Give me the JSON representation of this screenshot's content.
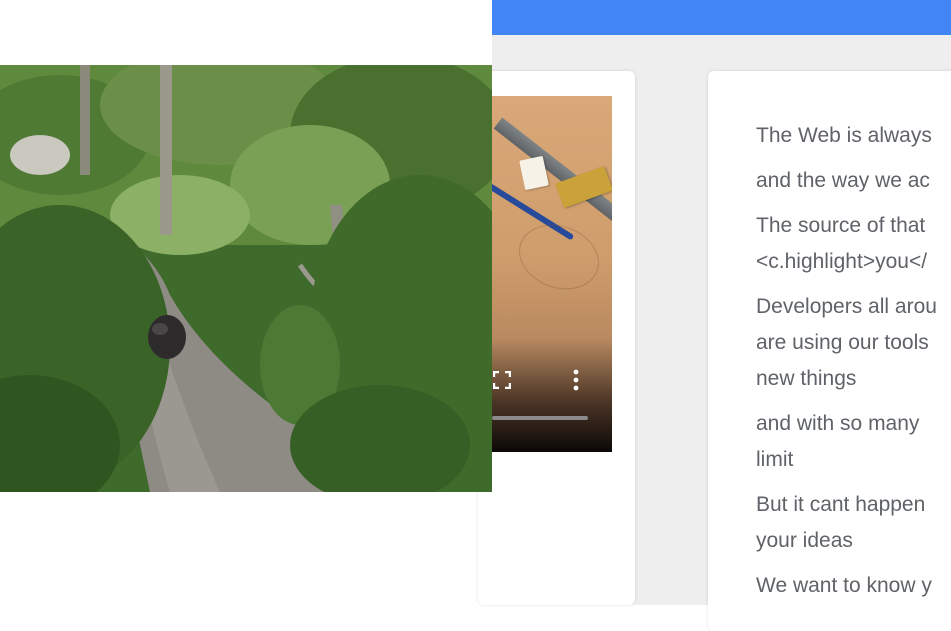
{
  "colors": {
    "app_bar": "#4285f4",
    "page_background": "#eeeeee",
    "card_background": "#ffffff",
    "body_text": "#5f6368"
  },
  "photo": {
    "icon": "forest-path-photo"
  },
  "video": {
    "controls": {
      "fullscreen_icon": "fullscreen-icon",
      "menu_icon": "more-vert-icon"
    }
  },
  "text_card": {
    "lines": [
      "The Web is always",
      "and the way we ac",
      "The source of that\n<c.highlight>you</",
      "Developers all arou\nare using our tools\nnew things",
      "and with so many\nlimit",
      "But it cant happen\nyour ideas",
      "We want to know y"
    ]
  }
}
